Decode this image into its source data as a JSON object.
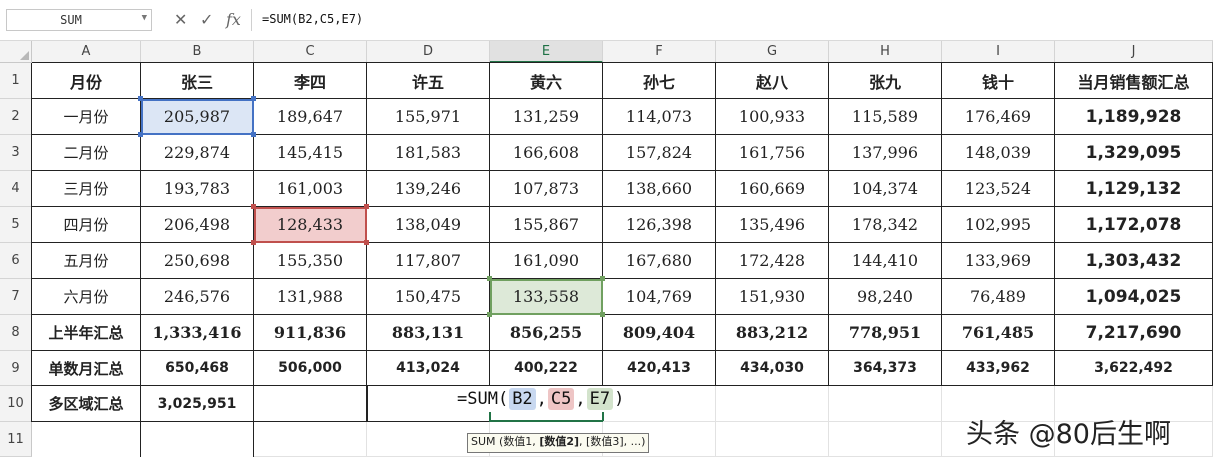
{
  "formula_bar": {
    "name_box": "SUM",
    "cancel_icon": "close-icon",
    "enter_icon": "check-icon",
    "fx_label": "fx",
    "formula": "=SUM(B2,C5,E7)"
  },
  "columns": [
    "A",
    "B",
    "C",
    "D",
    "E",
    "F",
    "G",
    "H",
    "I",
    "J"
  ],
  "selected_column": "E",
  "rows": [
    "1",
    "2",
    "3",
    "4",
    "5",
    "6",
    "7",
    "8",
    "9",
    "10",
    "11"
  ],
  "header_row": [
    "月份",
    "张三",
    "李四",
    "许五",
    "黄六",
    "孙七",
    "赵八",
    "张九",
    "钱十",
    "当月销售额汇总"
  ],
  "data_rows": [
    [
      "一月份",
      "205,987",
      "189,647",
      "155,971",
      "131,259",
      "114,073",
      "100,933",
      "115,589",
      "176,469",
      "1,189,928"
    ],
    [
      "二月份",
      "229,874",
      "145,415",
      "181,583",
      "166,608",
      "157,824",
      "161,756",
      "137,996",
      "148,039",
      "1,329,095"
    ],
    [
      "三月份",
      "193,783",
      "161,003",
      "139,246",
      "107,873",
      "138,660",
      "160,669",
      "104,374",
      "123,524",
      "1,129,132"
    ],
    [
      "四月份",
      "206,498",
      "128,433",
      "138,049",
      "155,867",
      "126,398",
      "135,496",
      "178,342",
      "102,995",
      "1,172,078"
    ],
    [
      "五月份",
      "250,698",
      "155,350",
      "117,807",
      "161,090",
      "167,680",
      "172,428",
      "144,410",
      "133,969",
      "1,303,432"
    ],
    [
      "六月份",
      "246,576",
      "131,988",
      "150,475",
      "133,558",
      "104,769",
      "151,930",
      "98,240",
      "76,489",
      "1,094,025"
    ]
  ],
  "half_year_row": [
    "上半年汇总",
    "1,333,416",
    "911,836",
    "883,131",
    "856,255",
    "809,404",
    "883,212",
    "778,951",
    "761,485",
    "7,217,690"
  ],
  "odd_month_row": [
    "单数月汇总",
    "650,468",
    "506,000",
    "413,024",
    "400,222",
    "420,413",
    "434,030",
    "364,373",
    "433,962",
    "3,622,492"
  ],
  "multi_area_row": [
    "多区域汇总",
    "3,025,951"
  ],
  "editing": {
    "prefix": "=SUM(",
    "ref1": "B2",
    "ref2": "C5",
    "ref3": "E7",
    "sep": ",",
    "suffix": ")",
    "tooltip_pre": "SUM (数值1, ",
    "tooltip_bold": "[数值2]",
    "tooltip_post": ", [数值3], ...)"
  },
  "colors": {
    "ref1": "#4472c4",
    "ref2": "#c0504d",
    "ref3": "#70a060",
    "excel_green": "#217346"
  },
  "watermark": "头条 @80后生啊"
}
